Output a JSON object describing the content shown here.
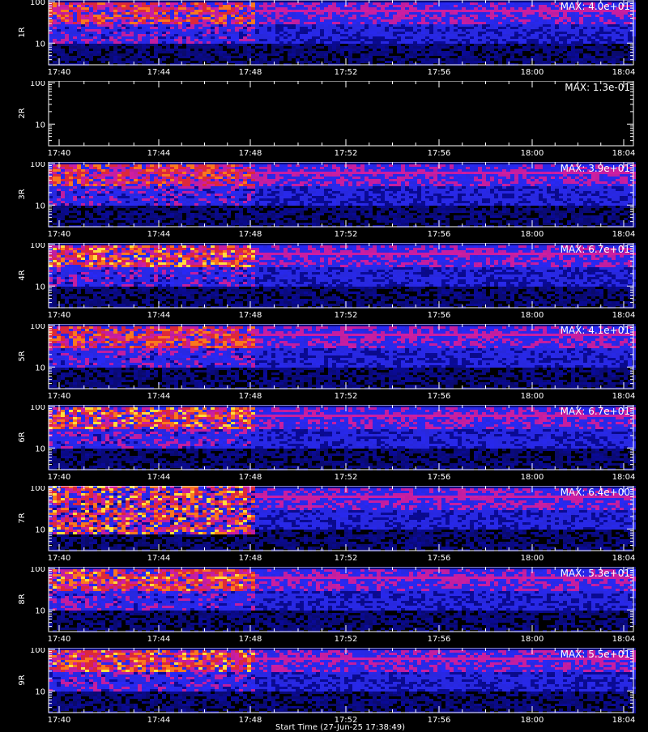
{
  "chart_data": {
    "type": "heatmap",
    "x_ticks": [
      "17:40",
      "17:44",
      "17:48",
      "17:52",
      "17:56",
      "18:00",
      "18:04"
    ],
    "x_range": [
      "17:38:50",
      "18:05:00"
    ],
    "y_ticks": [
      "10",
      "100"
    ],
    "y_scale": "log",
    "y_range": [
      3,
      110
    ],
    "colormap": "black-blue-red-yellow-white",
    "panels": [
      {
        "label": "1R",
        "max_label": "MAX: 4.0e+01",
        "max": 40.0,
        "active": true
      },
      {
        "label": "2R",
        "max_label": "MAX: 1.3e-01",
        "max": 0.13,
        "active": false
      },
      {
        "label": "3R",
        "max_label": "MAX: 3.9e+01",
        "max": 39.0,
        "active": true
      },
      {
        "label": "4R",
        "max_label": "MAX: 6.7e+01",
        "max": 67.0,
        "active": true
      },
      {
        "label": "5R",
        "max_label": "MAX: 4.1e+01",
        "max": 41.0,
        "active": true
      },
      {
        "label": "6R",
        "max_label": "MAX: 6.7e+01",
        "max": 67.0,
        "active": true
      },
      {
        "label": "7R",
        "max_label": "MAX: 6.4e+00",
        "max": 6.4,
        "active": true
      },
      {
        "label": "8R",
        "max_label": "MAX: 5.3e+01",
        "max": 53.0,
        "active": true
      },
      {
        "label": "9R",
        "max_label": "MAX: 5.5e+01",
        "max": 55.0,
        "active": true
      }
    ]
  },
  "footer": {
    "text": "Start Time (27-Jun-25 17:38:49)"
  }
}
